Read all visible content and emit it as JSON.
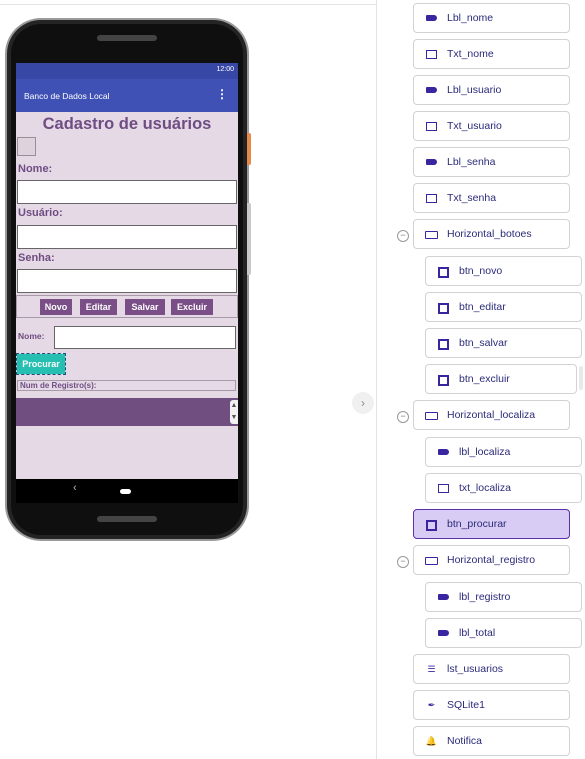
{
  "phone": {
    "status_time": "12:00",
    "app_title": "Banco de Dados Local",
    "heading": "Cadastro de usuários",
    "label_nome": "Nome:",
    "label_usuario": "Usuário:",
    "label_senha": "Senha:",
    "buttons": [
      "Novo",
      "Editar",
      "Salvar",
      "Excluir"
    ],
    "label_localiza": "Nome:",
    "button_procurar": "Procurar",
    "label_registros": "Num de Registro(s):"
  },
  "components": [
    {
      "name": "Lbl_nome",
      "icon": "label-icon"
    },
    {
      "name": "Txt_nome",
      "icon": "textbox-icon"
    },
    {
      "name": "Lbl_usuario",
      "icon": "label-icon"
    },
    {
      "name": "Txt_usuario",
      "icon": "textbox-icon"
    },
    {
      "name": "Lbl_senha",
      "icon": "label-icon"
    },
    {
      "name": "Txt_senha",
      "icon": "textbox-icon"
    },
    {
      "name": "Horizontal_botoes",
      "icon": "horizontal-arrangement-icon"
    },
    {
      "name": "btn_novo",
      "icon": "button-icon"
    },
    {
      "name": "btn_editar",
      "icon": "button-icon"
    },
    {
      "name": "btn_salvar",
      "icon": "button-icon"
    },
    {
      "name": "btn_excluir",
      "icon": "button-icon"
    },
    {
      "name": "Horizontal_localiza",
      "icon": "horizontal-arrangement-icon"
    },
    {
      "name": "lbl_localiza",
      "icon": "label-icon"
    },
    {
      "name": "txt_localiza",
      "icon": "textbox-icon"
    },
    {
      "name": "btn_procurar",
      "icon": "button-icon",
      "selected": true
    },
    {
      "name": "Horizontal_registro",
      "icon": "horizontal-arrangement-icon"
    },
    {
      "name": "lbl_registro",
      "icon": "label-icon"
    },
    {
      "name": "lbl_total",
      "icon": "label-icon"
    },
    {
      "name": "lst_usuarios",
      "icon": "listview-icon"
    },
    {
      "name": "SQLite1",
      "icon": "feather-icon"
    },
    {
      "name": "Notifica",
      "icon": "bell-icon"
    }
  ],
  "colors": {
    "accent": "#3f51b5",
    "purple_text": "#6e4d82",
    "button_purple": "#7a4e86",
    "procurar_teal": "#26bfb1",
    "selected_bg": "#d8cbf4"
  }
}
